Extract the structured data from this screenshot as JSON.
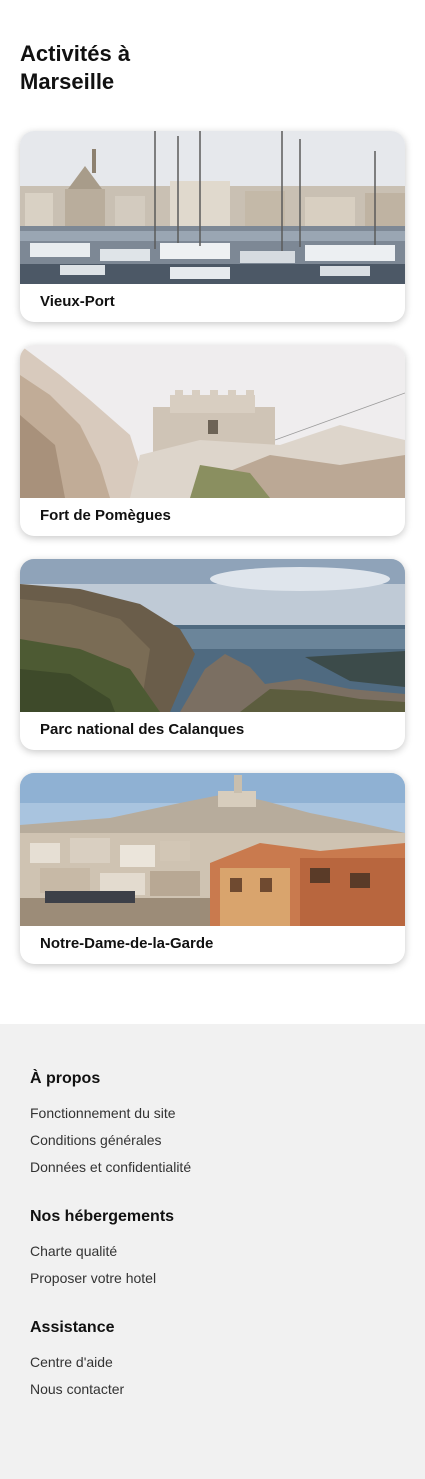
{
  "page": {
    "title": "Activités à Marseille"
  },
  "activities": [
    {
      "label": "Vieux-Port",
      "image": "marina-with-sailboats"
    },
    {
      "label": "Fort de Pomègues",
      "image": "stone-fort-on-rocks"
    },
    {
      "label": "Parc national des Calanques",
      "image": "cliffs-and-sea"
    },
    {
      "label": "Notre-Dame-de-la-Garde",
      "image": "hilltop-basilica-over-city"
    }
  ],
  "footer": {
    "sections": [
      {
        "title": "À propos",
        "links": [
          "Fonctionnement du site",
          "Conditions générales",
          "Données et confidentialité"
        ]
      },
      {
        "title": "Nos hébergements",
        "links": [
          "Charte qualité",
          "Proposer votre hotel"
        ]
      },
      {
        "title": "Assistance",
        "links": [
          "Centre d'aide",
          "Nous contacter"
        ]
      }
    ]
  }
}
